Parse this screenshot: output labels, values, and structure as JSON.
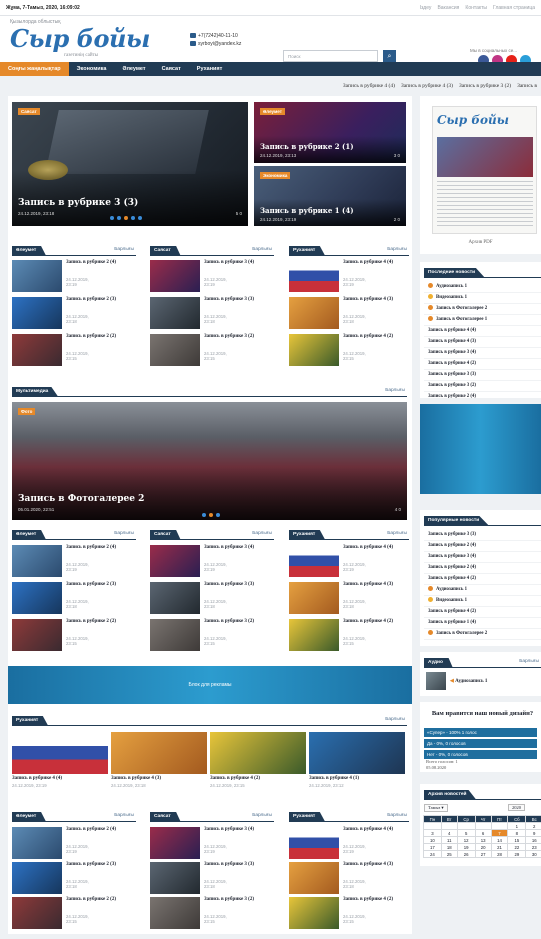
{
  "topbar": {
    "date": "Жұма, 7-Тамыз, 2020, 16:09:02",
    "links": [
      "Іздеу",
      "Вакансия",
      "Контакты",
      "Главная страница"
    ]
  },
  "header": {
    "region": "Қызылорда облыстық",
    "logo": "Сыр бойы",
    "logo_sub": "газетинің сайты",
    "phone": "+7(7242)40-11-10",
    "email": "syrboyi@yandex.kz",
    "search_placeholder": "Поиск",
    "social_label": "Мы в социальных се..."
  },
  "nav": {
    "items": [
      "Соңғы жаңалықтар",
      "Экономика",
      "Әлеумет",
      "Саясат",
      "Руханият"
    ]
  },
  "ticker": {
    "items": [
      "Запись в рубрике 4 (4)",
      "Запись в рубрике 4 (3)",
      "Запись в рубрике 3 (2)",
      "Запись в"
    ]
  },
  "hero": {
    "main": {
      "tag": "Саясат",
      "title": "Запись в рубрике 3 (3)",
      "date": "24.12.2019, 23:18",
      "stats": "5  0"
    },
    "side1": {
      "tag": "Әлеумет",
      "title": "Запись в рубрике 2 (1)",
      "date": "24.12.2019, 23:13",
      "stats": "3  0"
    },
    "side2": {
      "tag": "Экономика",
      "title": "Запись в рубрике 1 (4)",
      "date": "24.12.2019, 23:19",
      "stats": "2  0"
    }
  },
  "sections": {
    "all_label": "Барлығы",
    "aleumet": "Әлеумет",
    "sayasat": "Саясат",
    "ruhaniyat": "Руханият",
    "multimedia": "Мультимедиа"
  },
  "block1": {
    "col1": [
      {
        "title": "Запись в рубрике 2 (4)",
        "date": "24.12.2019, 23:19",
        "views": "0"
      },
      {
        "title": "Запись в рубрике 2 (3)",
        "date": "24.12.2019, 23:18",
        "views": "1"
      },
      {
        "title": "Запись в рубрике 2 (2)",
        "date": "24.12.2019, 23:15",
        "views": "0"
      }
    ],
    "col2": [
      {
        "title": "Запись в рубрике 3 (4)",
        "date": "24.12.2019, 23:19",
        "views": "2"
      },
      {
        "title": "Запись в рубрике 3 (3)",
        "date": "24.12.2019, 23:18",
        "views": "5"
      },
      {
        "title": "Запись в рубрике 3 (2)",
        "date": "24.12.2019, 23:15",
        "views": "0"
      }
    ],
    "col3": [
      {
        "title": "Запись в рубрике 4 (4)",
        "date": "24.12.2019, 23:19",
        "views": "0"
      },
      {
        "title": "Запись в рубрике 4 (3)",
        "date": "24.12.2019, 23:18",
        "views": "1"
      },
      {
        "title": "Запись в рубрике 4 (2)",
        "date": "24.12.2019, 23:15",
        "views": "0"
      }
    ]
  },
  "gallery": {
    "tag": "Фото",
    "title": "Запись в Фотогалерее 2",
    "date": "05.01.2020, 22:51",
    "stats": "4  0"
  },
  "ad_text": "Блок для рекламы",
  "ruhaniyat_row": [
    {
      "title": "Запись в рубрике 4 (4)",
      "date": "24.12.2019, 23:19",
      "views": "0"
    },
    {
      "title": "Запись в рубрике 4 (3)",
      "date": "24.12.2019, 23:18",
      "views": "1"
    },
    {
      "title": "Запись в рубрике 4 (2)",
      "date": "24.12.2019, 23:15",
      "views": "0"
    },
    {
      "title": "Запись в рубрике 4 (1)",
      "date": "24.12.2019, 23:12",
      "views": "0"
    }
  ],
  "sidebar": {
    "archive_label": "Архив PDF",
    "latest_title": "Последние новости",
    "latest": [
      "Аудиозапись 1",
      "Видеозапись 1",
      "Запись в Фотогалерее 2",
      "Запись в Фотогалерее 1",
      "Запись в рубрике 4 (4)",
      "Запись в рубрике 4 (3)",
      "Запись в рубрике 3 (4)",
      "Запись в рубрике 4 (2)",
      "Запись в рубрике 3 (3)",
      "Запись в рубрике 3 (2)",
      "Запись в рубрике 2 (4)"
    ],
    "popular_title": "Популярные новости",
    "popular": [
      "Запись в рубрике 3 (3)",
      "Запись в рубрике 2 (4)",
      "Запись в рубрике 3 (4)",
      "Запись в рубрике 2 (4)",
      "Запись в рубрике 4 (2)",
      "Аудиозапись 1",
      "Видеозапись 1",
      "Запись в рубрике 4 (2)",
      "Запись в рубрике 1 (4)",
      "Запись в Фотогалерее 2"
    ],
    "audio_title": "Аудио",
    "audio_all": "Барлығы",
    "audio_item": "Аудиозапись 1",
    "poll_question": "Вам нравится наш новый дизайн?",
    "poll_options": [
      "«Супер» - 100% 1 голос",
      "Да - 0%, 0 голосов",
      "Нет - 0%, 0 голосов"
    ],
    "poll_total": "Всего голосов: 1",
    "poll_date": "05.08.2020",
    "archive_title": "Архив новостей",
    "cal_month": "Тамыз",
    "cal_year": "2020",
    "cal_days": [
      "Пн",
      "Вт",
      "Ср",
      "Чт",
      "Пт",
      "Сб",
      "Вс"
    ],
    "cal_rows": [
      [
        "",
        "",
        "",
        "",
        "",
        "1",
        "2"
      ],
      [
        "3",
        "4",
        "5",
        "6",
        "7",
        "8",
        "9"
      ],
      [
        "10",
        "11",
        "12",
        "13",
        "14",
        "15",
        "16"
      ],
      [
        "17",
        "18",
        "19",
        "20",
        "21",
        "22",
        "23"
      ],
      [
        "24",
        "25",
        "26",
        "27",
        "28",
        "29",
        "30"
      ]
    ],
    "cal_today": "7"
  },
  "colors": {
    "nav": "#213b54",
    "accent": "#e5892a",
    "logo": "#2b6fb0",
    "ad": "#2c9ccf"
  }
}
